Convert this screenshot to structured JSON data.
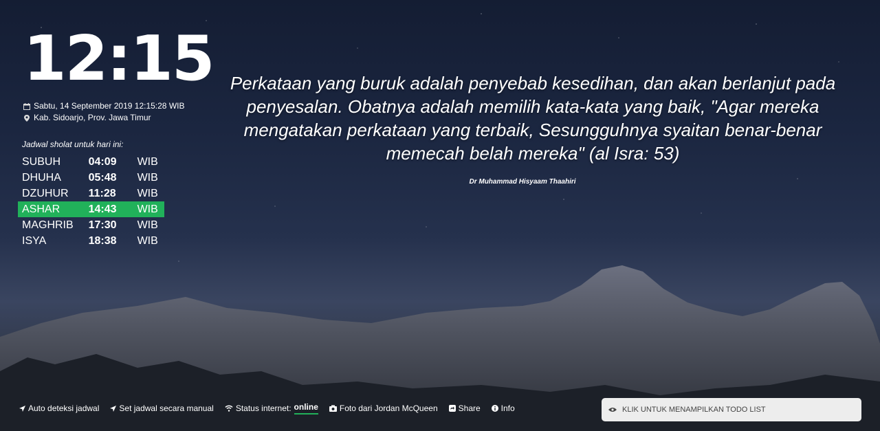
{
  "clock": {
    "time": "12:15"
  },
  "meta": {
    "date": "Sabtu, 14 September 2019 12:15:28 WIB",
    "location": "Kab. Sidoarjo, Prov. Jawa Timur"
  },
  "schedule": {
    "title": "Jadwal sholat untuk hari ini:",
    "rows": [
      {
        "name": "SUBUH",
        "time": "04:09",
        "tz": "WIB"
      },
      {
        "name": "DHUHA",
        "time": "05:48",
        "tz": "WIB"
      },
      {
        "name": "DZUHUR",
        "time": "11:28",
        "tz": "WIB"
      },
      {
        "name": "ASHAR",
        "time": "14:43",
        "tz": "WIB"
      },
      {
        "name": "MAGHRIB",
        "time": "17:30",
        "tz": "WIB"
      },
      {
        "name": "ISYA",
        "time": "18:38",
        "tz": "WIB"
      }
    ],
    "active_index": 3,
    "active_color": "#21b15a"
  },
  "quote": {
    "text": "Perkataan yang buruk adalah penyebab kesedihan, dan akan berlanjut pada penyesalan. Obatnya adalah memilih kata-kata yang baik, \"Agar mereka mengatakan perkataan yang terbaik, Sesungguhnya syaitan benar-benar memecah belah mereka\" (al Isra: 53)",
    "author": "Dr Muhammad Hisyaam Thaahiri"
  },
  "footer": {
    "auto_detect": "Auto deteksi jadwal",
    "manual": "Set jadwal secara manual",
    "status_label": "Status internet:",
    "status_value": "online",
    "photo": "Foto dari Jordan McQueen",
    "share": "Share",
    "info": "Info"
  },
  "todo": {
    "label": "KLIK UNTUK MENAMPILKAN TODO LIST"
  },
  "icons": {
    "calendar": "calendar-icon",
    "location": "map-marker-icon",
    "arrow": "location-arrow-icon",
    "wifi": "wifi-icon",
    "camera": "camera-icon",
    "share": "share-square-icon",
    "info": "info-circle-icon",
    "eye": "eye-icon"
  }
}
